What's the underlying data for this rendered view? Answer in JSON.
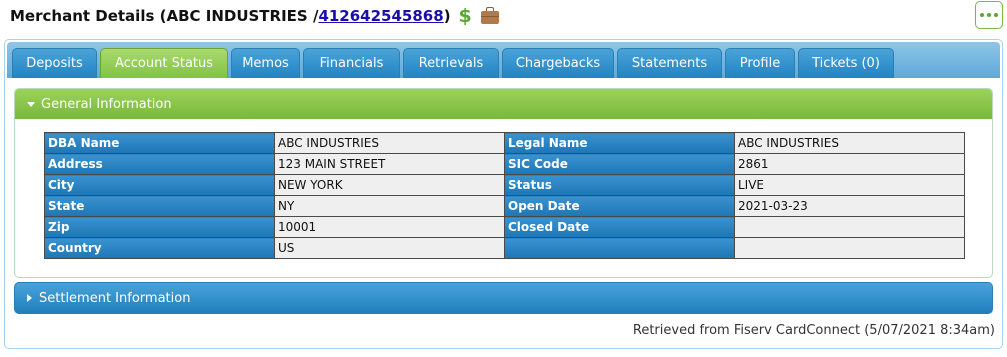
{
  "header": {
    "title_prefix": "Merchant Details (ABC INDUSTRIES / ",
    "merchant_id": "412642545868",
    "title_suffix": ")",
    "dollar_icon": "$",
    "icons": [
      "dollar-icon",
      "briefcase-icon"
    ]
  },
  "more_button": {
    "icon": "ellipsis-icon"
  },
  "tabs": [
    {
      "label": "Deposits",
      "active": false
    },
    {
      "label": "Account Status",
      "active": true
    },
    {
      "label": "Memos",
      "active": false
    },
    {
      "label": "Financials",
      "active": false
    },
    {
      "label": "Retrievals",
      "active": false
    },
    {
      "label": "Chargebacks",
      "active": false
    },
    {
      "label": "Statements",
      "active": false
    },
    {
      "label": "Profile",
      "active": false
    },
    {
      "label": "Tickets (0)",
      "active": false
    }
  ],
  "general_info": {
    "title": "General Information",
    "rows": [
      {
        "label1": "DBA Name",
        "value1": "ABC INDUSTRIES",
        "label2": "Legal Name",
        "value2": "ABC INDUSTRIES"
      },
      {
        "label1": "Address",
        "value1": "123 MAIN STREET",
        "label2": "SIC Code",
        "value2": "2861"
      },
      {
        "label1": "City",
        "value1": "NEW YORK",
        "label2": "Status",
        "value2": "LIVE"
      },
      {
        "label1": "State",
        "value1": "NY",
        "label2": "Open Date",
        "value2": "2021-03-23"
      },
      {
        "label1": "Zip",
        "value1": "10001",
        "label2": "Closed Date",
        "value2": ""
      },
      {
        "label1": "Country",
        "value1": "US",
        "label2": "",
        "value2": ""
      }
    ]
  },
  "settlement_info": {
    "title": "Settlement Information"
  },
  "footer": {
    "text": "Retrieved from Fiserv CardConnect (5/07/2021 8:34am)"
  },
  "colors": {
    "tab_blue": "#2184c3",
    "tab_active_green": "#82c341",
    "section_green": "#78b83a",
    "label_blue": "#1d76b5",
    "value_bg": "#efefef"
  }
}
